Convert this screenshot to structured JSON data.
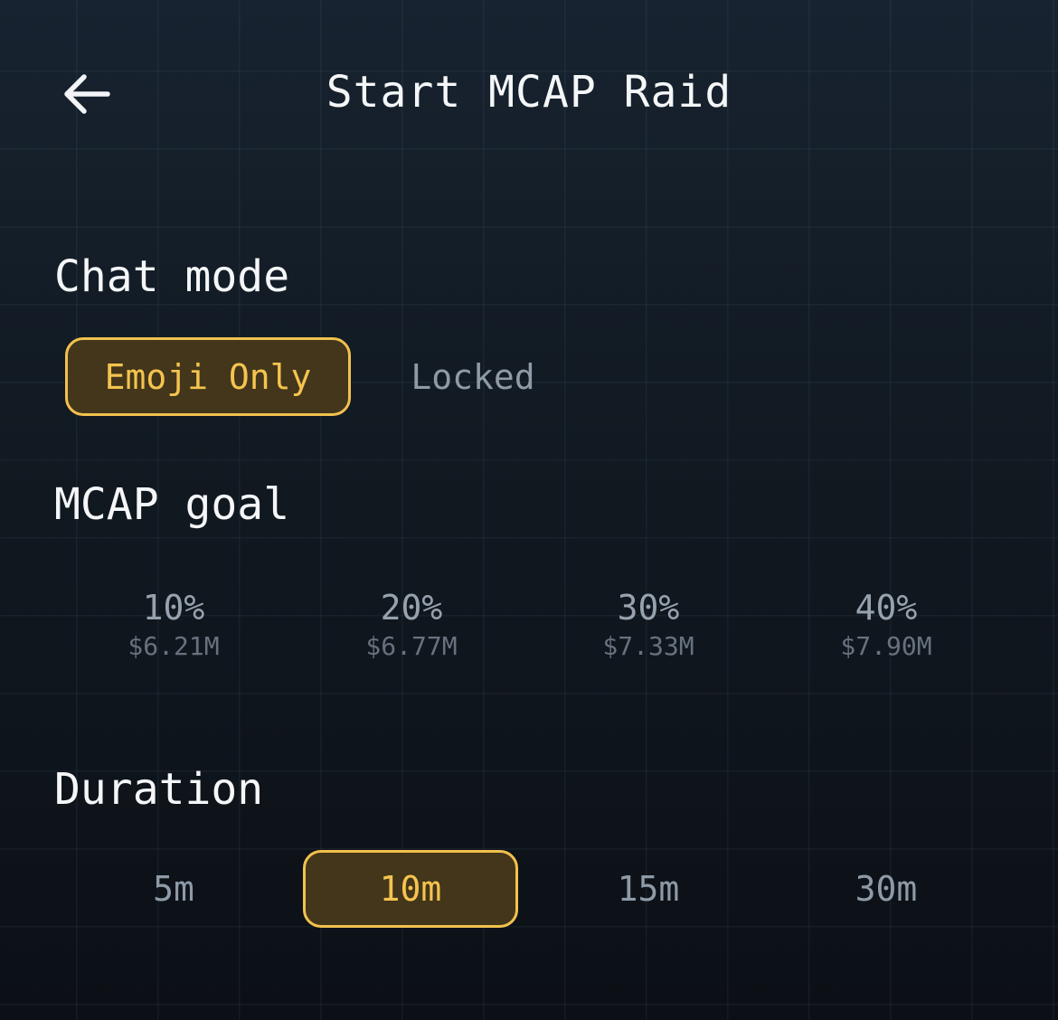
{
  "header": {
    "title": "Start MCAP Raid",
    "back_icon": "arrow-left-icon"
  },
  "chat_mode": {
    "label": "Chat mode",
    "options": [
      "Emoji Only",
      "Locked"
    ],
    "selected": "Emoji Only"
  },
  "mcap_goal": {
    "label": "MCAP goal",
    "options": [
      {
        "percent": "10%",
        "value": "$6.21M"
      },
      {
        "percent": "20%",
        "value": "$6.77M"
      },
      {
        "percent": "30%",
        "value": "$7.33M"
      },
      {
        "percent": "40%",
        "value": "$7.90M"
      }
    ]
  },
  "duration": {
    "label": "Duration",
    "options": [
      "5m",
      "10m",
      "15m",
      "30m"
    ],
    "selected": "10m"
  },
  "colors": {
    "accent": "#f2c14e",
    "accent_fill": "#43361a",
    "muted_text": "#8e9aa6",
    "background_top": "#172330",
    "background_bottom": "#0c1016"
  }
}
